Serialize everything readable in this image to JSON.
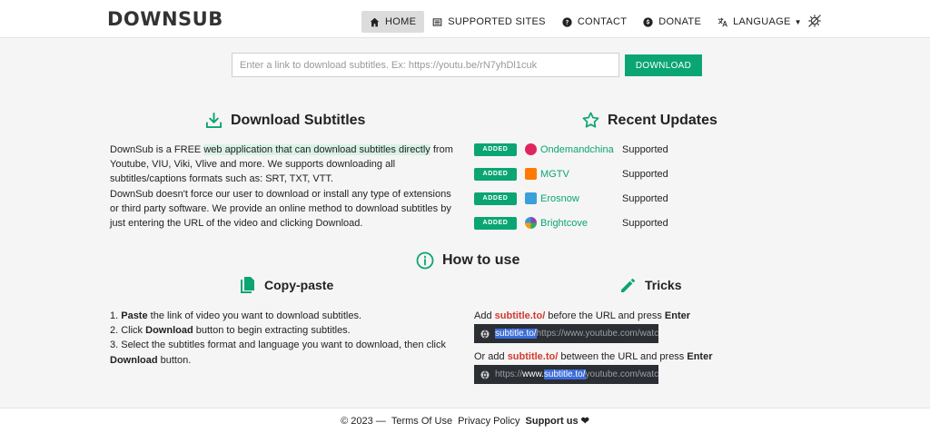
{
  "header": {
    "logo": "DOWNSUB",
    "nav": [
      {
        "label": "HOME",
        "icon": "home-icon"
      },
      {
        "label": "SUPPORTED SITES",
        "icon": "list-icon"
      },
      {
        "label": "CONTACT",
        "icon": "question-icon"
      },
      {
        "label": "DONATE",
        "icon": "dollar-icon"
      },
      {
        "label": "LANGUAGE",
        "icon": "translate-icon"
      }
    ]
  },
  "search": {
    "placeholder": "Enter a link to download subtitles. Ex: https://youtu.be/rN7yhDl1cuk",
    "value": "",
    "button_label": "DOWNLOAD"
  },
  "about": {
    "title": "Download Subtitles",
    "p1_before": "DownSub is a FREE ",
    "p1_highlight": "web application that can download subtitles directly",
    "p1_after": " from Youtube, VIU, Viki, Vlive and more. We supports downloading all subtitles/captions formats such as: SRT, TXT, VTT.",
    "p2": "DownSub doesn't force our user to download or install any type of extensions or third party software. We provide an online method to download subtitles by just entering the URL of the video and clicking Download."
  },
  "updates": {
    "title": "Recent Updates",
    "badge": "ADDED",
    "items": [
      {
        "name": "Ondemandchina",
        "status": "Supported",
        "color": "#e0245e"
      },
      {
        "name": "MGTV",
        "status": "Supported",
        "color": "#ff7a00"
      },
      {
        "name": "Erosnow",
        "status": "Supported",
        "color": "#3aa0d8"
      },
      {
        "name": "Brightcove",
        "status": "Supported",
        "color": "#8e44ad"
      }
    ]
  },
  "howto": {
    "title": "How to use",
    "copy_title": "Copy-paste",
    "tricks_title": "Tricks",
    "step1_num": "1. ",
    "step1_bold": "Paste",
    "step1_rest": " the link of video you want to download subtitles.",
    "step2_num": "2. Click ",
    "step2_bold": "Download",
    "step2_rest": " button to begin extracting subtitles.",
    "step3_text": "3. Select the subtitles format and language you want to download, then click ",
    "step3_bold": "Download",
    "step3_rest": " button.",
    "trick1_pre": "Add ",
    "trick1_red": "subtitle.to/",
    "trick1_mid": " before the URL and press ",
    "trick1_key": "Enter",
    "url1_sel": "subtitle.to/",
    "url1_rest": "https://www.youtube.com/watch?v",
    "trick2_pre": "Or add ",
    "trick2_red": "subtitle.to/",
    "trick2_mid": " between the URL and press ",
    "trick2_key": "Enter",
    "url2_pre": "https://",
    "url2_www": "www.",
    "url2_sel": "subtitle.to/",
    "url2_rest": "youtube.com/watch?v="
  },
  "footer": {
    "copyright": "© 2023 —",
    "terms": "Terms Of Use",
    "privacy": "Privacy Policy",
    "support": "Support us",
    "heart": "❤"
  },
  "colors": {
    "accent": "#0aa573",
    "red": "#d13b2f"
  }
}
